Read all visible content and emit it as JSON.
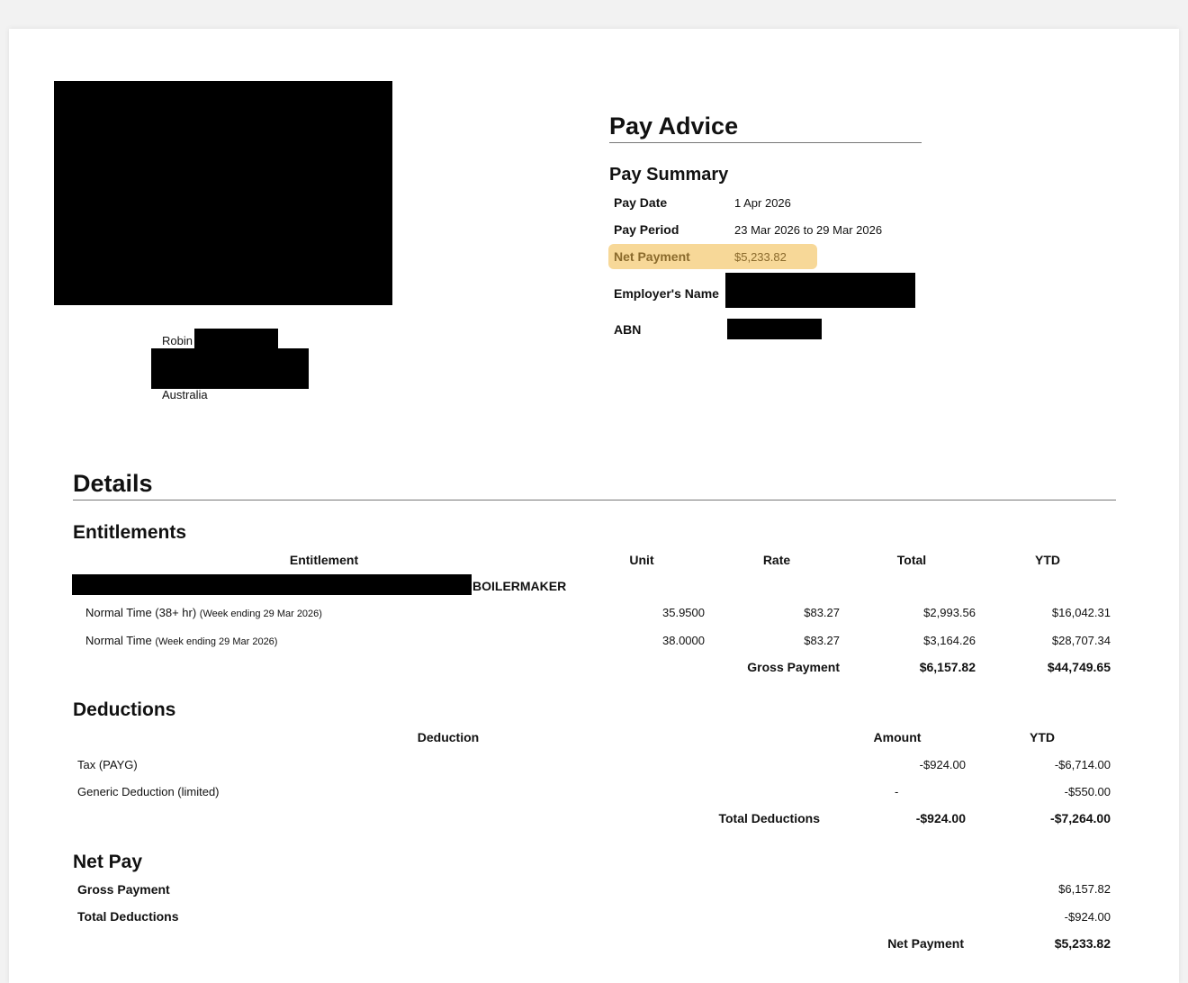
{
  "header": {
    "title": "Pay Advice",
    "summary_title": "Pay Summary"
  },
  "address": {
    "first_name": "Robin",
    "country": "Australia"
  },
  "summary": {
    "pay_date_label": "Pay Date",
    "pay_date": "1 Apr 2026",
    "pay_period_label": "Pay Period",
    "pay_period": "23 Mar 2026 to 29 Mar 2026",
    "net_payment_label": "Net Payment",
    "net_payment": "$5,233.82",
    "employer_label": "Employer's Name",
    "abn_label": "ABN"
  },
  "details": {
    "title": "Details"
  },
  "entitlements": {
    "title": "Entitlements",
    "columns": [
      "Entitlement",
      "Unit",
      "Rate",
      "Total",
      "YTD"
    ],
    "group_label": "BOILERMAKER",
    "rows": [
      {
        "name": "Normal Time (38+ hr)",
        "note": "(Week ending 29 Mar 2026)",
        "unit": "35.9500",
        "rate": "$83.27",
        "total": "$2,993.56",
        "ytd": "$16,042.31"
      },
      {
        "name": "Normal Time",
        "note": "(Week ending 29 Mar 2026)",
        "unit": "38.0000",
        "rate": "$83.27",
        "total": "$3,164.26",
        "ytd": "$28,707.34"
      }
    ],
    "total_label": "Gross Payment",
    "total": "$6,157.82",
    "total_ytd": "$44,749.65"
  },
  "deductions": {
    "title": "Deductions",
    "columns": [
      "Deduction",
      "Amount",
      "YTD"
    ],
    "rows": [
      {
        "name": "Tax (PAYG)",
        "amount": "-$924.00",
        "ytd": "-$6,714.00"
      },
      {
        "name": "Generic Deduction (limited)",
        "amount": "-",
        "ytd": "-$550.00"
      }
    ],
    "total_label": "Total Deductions",
    "total": "-$924.00",
    "total_ytd": "-$7,264.00"
  },
  "net_pay": {
    "title": "Net Pay",
    "gross_label": "Gross Payment",
    "gross": "$6,157.82",
    "deductions_label": "Total Deductions",
    "deductions": "-$924.00",
    "net_label": "Net Payment",
    "net": "$5,233.82"
  },
  "colors": {
    "highlight": "#f7d898",
    "highlight_text": "#8a6a2c"
  }
}
